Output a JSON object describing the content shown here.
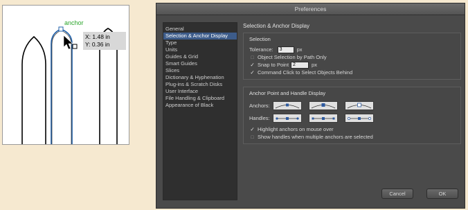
{
  "canvas": {
    "anchor_label": "anchor",
    "coord_x": "X: 1.48 in",
    "coord_y": "Y: 0.36 in"
  },
  "dialog": {
    "title": "Preferences",
    "categories": [
      "General",
      "Selection & Anchor Display",
      "Type",
      "Units",
      "Guides & Grid",
      "Smart Guides",
      "Slices",
      "Dictionary & Hyphenation",
      "Plug-ins & Scratch Disks",
      "User Interface",
      "File Handling & Clipboard",
      "Appearance of Black"
    ],
    "selected_category": "Selection & Anchor Display",
    "page_title": "Selection & Anchor Display",
    "selection_group": {
      "title": "Selection",
      "tolerance_label": "Tolerance:",
      "tolerance_value": "3",
      "tolerance_unit": "px",
      "object_selection_label": "Object Selection by Path Only",
      "object_selection_checked": false,
      "snap_label": "Snap to Point",
      "snap_value": "2",
      "snap_unit": "px",
      "snap_checked": true,
      "command_click_label": "Command Click to Select Objects Behind",
      "command_click_checked": true
    },
    "anchor_group": {
      "title": "Anchor Point and Handle Display",
      "anchors_label": "Anchors:",
      "handles_label": "Handles:",
      "highlight_label": "Highlight anchors on mouse over",
      "highlight_checked": true,
      "show_handles_label": "Show handles when multiple anchors are selected",
      "show_handles_checked": false
    },
    "buttons": {
      "cancel": "Cancel",
      "ok": "OK"
    }
  },
  "colors": {
    "accent_selected": "#3d5c8a",
    "anchor_green": "#2aa52a",
    "path_blue": "#1f5fa8"
  }
}
